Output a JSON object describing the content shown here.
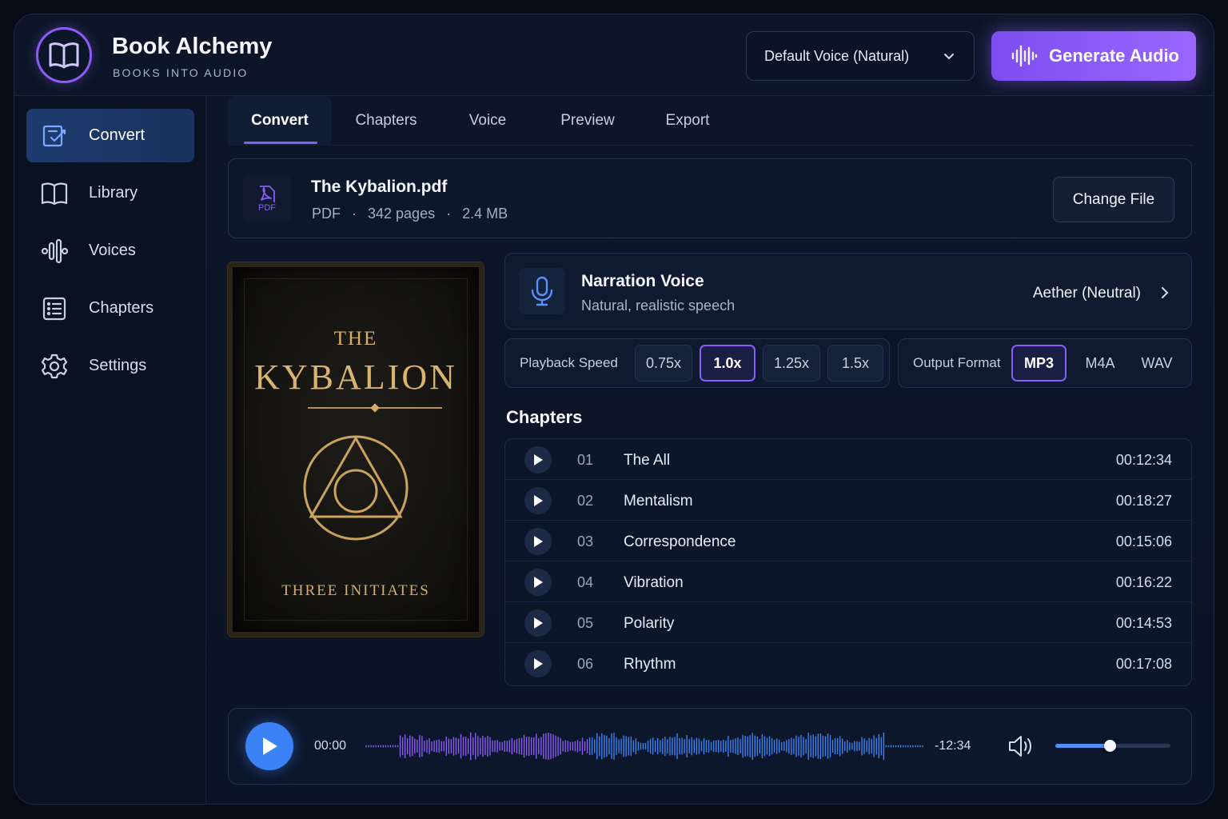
{
  "app": {
    "title": "Book Alchemy",
    "subtitle": "BOOKS INTO AUDIO",
    "accent": "#8b5cf6",
    "icon": "open-book-icon"
  },
  "header": {
    "voice_select": "Default Voice (Natural)",
    "generate_label": "Generate Audio"
  },
  "sidebar": {
    "items": [
      {
        "label": "Convert",
        "icon": "convert-icon",
        "active": true
      },
      {
        "label": "Library",
        "icon": "book-icon"
      },
      {
        "label": "Voices",
        "icon": "audio-wave-icon"
      },
      {
        "label": "Chapters",
        "icon": "list-icon"
      },
      {
        "label": "Settings",
        "icon": "gear-icon"
      }
    ]
  },
  "tabs": [
    {
      "label": "Convert",
      "active": true
    },
    {
      "label": "Chapters"
    },
    {
      "label": "Voice"
    },
    {
      "label": "Preview"
    },
    {
      "label": "Export"
    }
  ],
  "file": {
    "icon_label": "PDF",
    "name": "The Kybalion.pdf",
    "type": "PDF",
    "pages": "342 pages",
    "size": "2.4 MB",
    "sep": "·",
    "change_label": "Change File"
  },
  "cover": {
    "the": "THE",
    "title": "KYBALION",
    "author": "THREE INITIATES"
  },
  "narration": {
    "title": "Narration Voice",
    "subtitle": "Natural, realistic speech",
    "value": "Aether (Neutral)"
  },
  "speed": {
    "label": "Playback Speed",
    "options": [
      "0.75x",
      "1.0x",
      "1.25x",
      "1.5x"
    ],
    "selected": "1.0x"
  },
  "format": {
    "label": "Output Format",
    "options": [
      "MP3",
      "M4A",
      "WAV"
    ],
    "selected": "MP3"
  },
  "chapters": {
    "heading": "Chapters",
    "items": [
      {
        "num": "01",
        "name": "The All",
        "duration": "00:12:34"
      },
      {
        "num": "02",
        "name": "Mentalism",
        "duration": "00:18:27"
      },
      {
        "num": "03",
        "name": "Correspondence",
        "duration": "00:15:06"
      },
      {
        "num": "04",
        "name": "Vibration",
        "duration": "00:16:22"
      },
      {
        "num": "05",
        "name": "Polarity",
        "duration": "00:14:53"
      },
      {
        "num": "06",
        "name": "Rhythm",
        "duration": "00:17:08"
      }
    ]
  },
  "player": {
    "current_time": "00:00",
    "remaining_time": "-12:34",
    "volume": 0.47,
    "wave_colors": [
      "#8b5cf6",
      "#3b82f6"
    ]
  }
}
